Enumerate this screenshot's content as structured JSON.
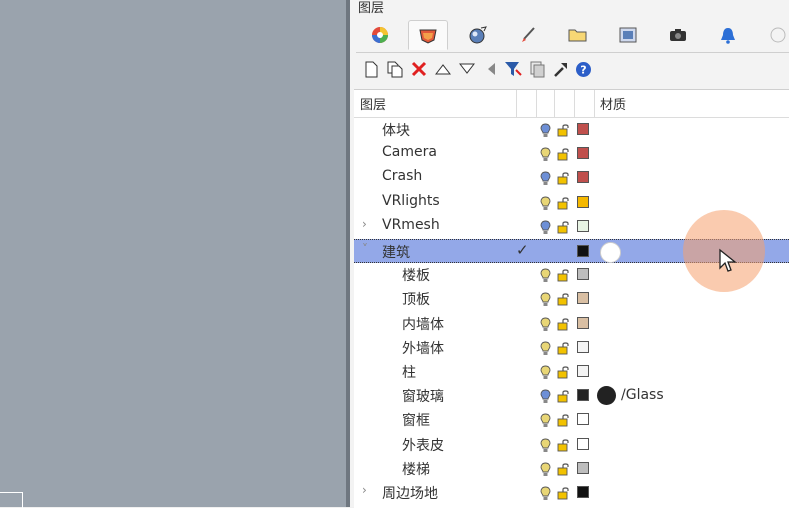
{
  "panel": {
    "title": "图层"
  },
  "tabs": [
    {
      "icon": "color-wheel-icon",
      "active": false
    },
    {
      "icon": "layers-icon",
      "active": true
    },
    {
      "icon": "sphere-render-icon",
      "active": false
    },
    {
      "icon": "brush-icon",
      "active": false
    },
    {
      "icon": "folder-icon",
      "active": false
    },
    {
      "icon": "image-icon",
      "active": false
    },
    {
      "icon": "camera-icon",
      "active": false
    },
    {
      "icon": "bell-icon",
      "active": false
    },
    {
      "icon": "clock-icon",
      "active": false
    }
  ],
  "toolbar": [
    {
      "icon": "new-layer-icon"
    },
    {
      "icon": "new-sublayer-icon"
    },
    {
      "icon": "delete-icon"
    },
    {
      "icon": "move-up-icon"
    },
    {
      "icon": "move-down-icon"
    },
    {
      "icon": "move-parent-icon"
    },
    {
      "icon": "filter-icon"
    },
    {
      "icon": "copy-icon"
    },
    {
      "icon": "tools-icon"
    },
    {
      "icon": "help-icon"
    }
  ],
  "grid": {
    "header": {
      "layer_col": "图层",
      "material_col": "材质"
    },
    "rows": [
      {
        "name": "体块",
        "level": 1,
        "expander": "",
        "bulb": "on",
        "color": "#c0504d",
        "current": false,
        "material": "",
        "material_color": ""
      },
      {
        "name": "Camera",
        "level": 1,
        "expander": "",
        "bulb": "off",
        "color": "#c0504d",
        "current": false,
        "material": "",
        "material_color": ""
      },
      {
        "name": "Crash",
        "level": 1,
        "expander": "",
        "bulb": "on",
        "color": "#c0504d",
        "current": false,
        "material": "",
        "material_color": ""
      },
      {
        "name": "VRlights",
        "level": 1,
        "expander": "",
        "bulb": "off",
        "color": "#f5b800",
        "current": false,
        "material": "",
        "material_color": ""
      },
      {
        "name": "VRmesh",
        "level": 1,
        "expander": "›",
        "bulb": "on",
        "color": "#e8f4e4",
        "current": false,
        "material": "",
        "material_color": ""
      },
      {
        "name": "建筑",
        "level": 1,
        "expander": "˅",
        "bulb": "",
        "color": "#111111",
        "current": true,
        "material": "",
        "material_color": "#ffffff"
      },
      {
        "name": "楼板",
        "level": 2,
        "expander": "",
        "bulb": "off",
        "color": "#bdbdbd",
        "current": false,
        "material": "",
        "material_color": ""
      },
      {
        "name": "顶板",
        "level": 2,
        "expander": "",
        "bulb": "off",
        "color": "#d9bfa3",
        "current": false,
        "material": "",
        "material_color": ""
      },
      {
        "name": "内墙体",
        "level": 2,
        "expander": "",
        "bulb": "off",
        "color": "#d9bfa3",
        "current": false,
        "material": "",
        "material_color": ""
      },
      {
        "name": "外墙体",
        "level": 2,
        "expander": "",
        "bulb": "off",
        "color": "#f4f4f4",
        "current": false,
        "material": "",
        "material_color": ""
      },
      {
        "name": "柱",
        "level": 2,
        "expander": "",
        "bulb": "off",
        "color": "#f4f4f4",
        "current": false,
        "material": "",
        "material_color": ""
      },
      {
        "name": "窗玻璃",
        "level": 2,
        "expander": "",
        "bulb": "on",
        "color": "#222222",
        "current": false,
        "material": "/Glass",
        "material_color": "#222222"
      },
      {
        "name": "窗框",
        "level": 2,
        "expander": "",
        "bulb": "off",
        "color": "#ffffff",
        "current": false,
        "material": "",
        "material_color": ""
      },
      {
        "name": "外表皮",
        "level": 2,
        "expander": "",
        "bulb": "off",
        "color": "#ffffff",
        "current": false,
        "material": "",
        "material_color": ""
      },
      {
        "name": "楼梯",
        "level": 2,
        "expander": "",
        "bulb": "off",
        "color": "#bdbdbd",
        "current": false,
        "material": "",
        "material_color": ""
      },
      {
        "name": "周边场地",
        "level": 1,
        "expander": "›",
        "bulb": "off",
        "color": "#111111",
        "current": false,
        "material": "",
        "material_color": ""
      }
    ]
  },
  "colors": {
    "selection": "#93a8e8",
    "bulb_on": "#6d8fd6",
    "bulb_off": "#e8d676",
    "lock": "#f2c200"
  }
}
